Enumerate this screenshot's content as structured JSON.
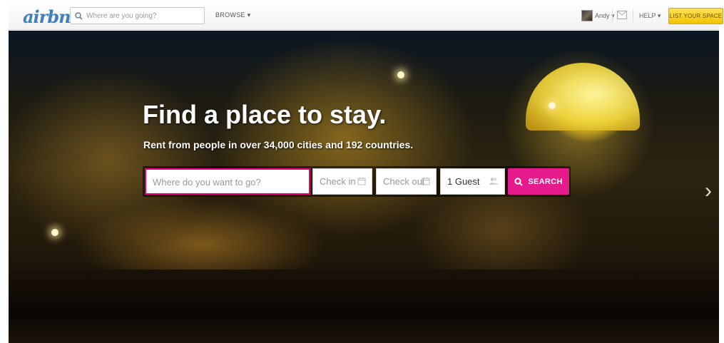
{
  "header": {
    "logo": "airbnb",
    "search_placeholder": "Where are you going?",
    "browse_label": "BROWSE ▾",
    "user_label": "Andy ▾",
    "help_label": "HELP ▾",
    "list_space_label": "LIST YOUR SPACE"
  },
  "hero": {
    "title": "Find a place to stay.",
    "subtitle": "Rent from people in over 34,000 cities and 192 countries.",
    "where_placeholder": "Where do you want to go?",
    "checkin_placeholder": "Check in",
    "checkout_placeholder": "Check out",
    "guests_value": "1 Guest",
    "search_label": "SEARCH",
    "next_arrow": "›"
  },
  "colors": {
    "brand_blue": "#3f7fbf",
    "search_pink": "#e61b8b",
    "list_yellow": "#f3c400"
  },
  "icons": [
    "search-icon",
    "mail-icon",
    "calendar-icon",
    "guests-icon",
    "chevron-right-icon"
  ]
}
